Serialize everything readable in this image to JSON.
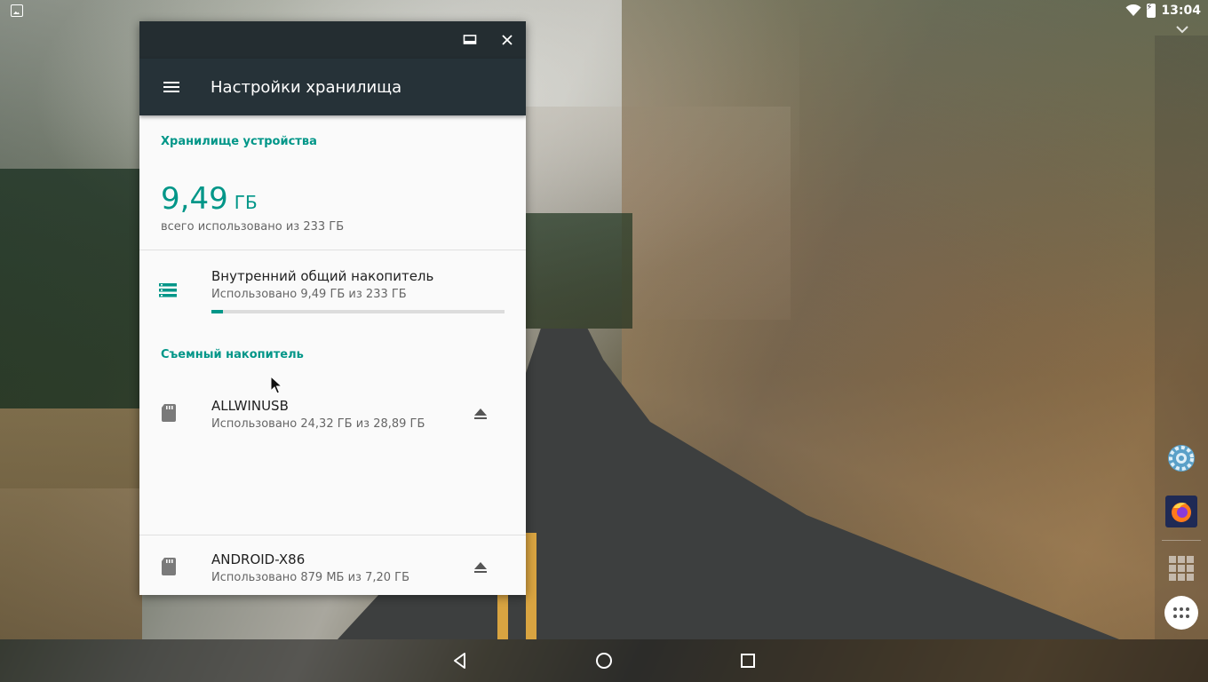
{
  "window": {
    "title": "Настройки хранилища"
  },
  "storage": {
    "device_section_header": "Хранилище устройства",
    "total_used_value": "9,49",
    "total_used_unit": "ГБ",
    "total_used_caption": "всего использовано из 233 ГБ",
    "internal": {
      "name": "Внутренний общий накопитель",
      "usage": "Использовано 9,49 ГБ из 233 ГБ",
      "used_fraction": 0.04
    },
    "removable_section_header": "Съемный накопитель",
    "removable": [
      {
        "name": "ALLWINUSB",
        "usage": "Использовано 24,32 ГБ из 28,89 ГБ"
      },
      {
        "name": "ANDROID-X86",
        "usage": "Использовано 879 МБ из 7,20 ГБ"
      }
    ]
  },
  "status_bar": {
    "time": "13:04"
  },
  "colors": {
    "accent": "#009688",
    "appbar": "#263238",
    "titlebar": "#242d31"
  },
  "icons": {
    "window_maximize": "maximize-icon",
    "window_close": "close-icon",
    "menu": "hamburger-menu-icon",
    "internal_storage": "storage-list-icon",
    "sd_card": "sd-card-icon",
    "eject": "eject-icon",
    "dock": [
      "settings-gear-icon",
      "firefox-icon",
      "app-grid-icon",
      "all-apps-icon"
    ],
    "nav": [
      "back-icon",
      "home-icon",
      "recents-icon"
    ]
  }
}
